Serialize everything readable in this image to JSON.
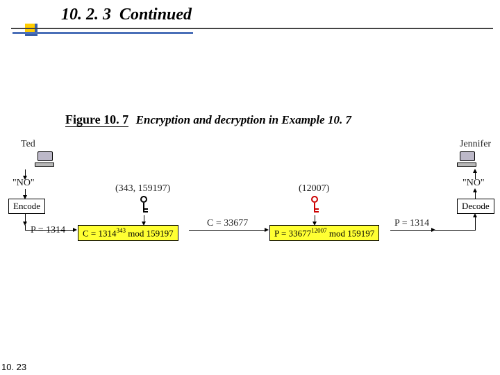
{
  "header": {
    "section_number": "10. 2. 3",
    "section_word": "Continued"
  },
  "caption": {
    "figure_label": "Figure 10. 7",
    "description": "Encryption and decryption in Example 10. 7"
  },
  "diagram": {
    "left_person": "Ted",
    "right_person": "Jennifer",
    "plaintext_no_left": "\"NO\"",
    "plaintext_no_right": "\"NO\"",
    "encode_label": "Encode",
    "decode_label": "Decode",
    "p_left": "P = 1314",
    "p_right": "P = 1314",
    "public_key": "(343, 159197)",
    "private_key": "(12007)",
    "cipher_formula_prefix": "C = 1314",
    "cipher_exp": "343",
    "cipher_formula_suffix": " mod 159197",
    "cipher_value": "C = 33677",
    "plain_formula_prefix": "P = 33677",
    "plain_exp": "12007",
    "plain_formula_suffix": " mod 159197"
  },
  "page_number": "10. 23",
  "colors": {
    "accent_blue": "#3a5fa8",
    "accent_yellow": "#ffcc00",
    "formula_bg": "#ffff33",
    "private_key": "#cc0000"
  }
}
